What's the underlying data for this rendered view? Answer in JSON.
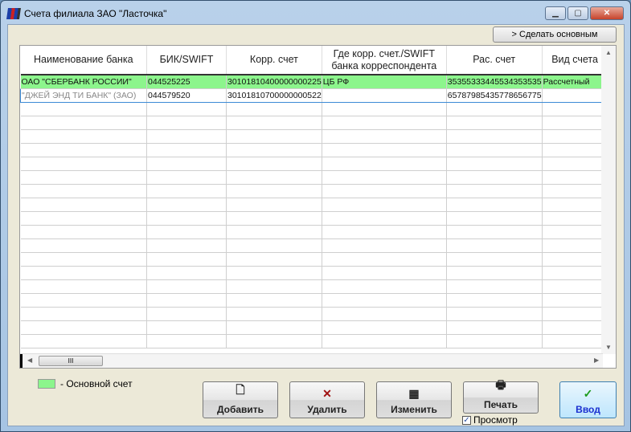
{
  "window": {
    "title": "Счета филиала ЗАО \"Ласточка\""
  },
  "toolbar": {
    "make_main_label": "> Сделать основным"
  },
  "table": {
    "columns": [
      "Наименование банка",
      "БИК/SWIFT",
      "Корр. счет",
      "Где корр. счет./SWIFT банка корреспондента",
      "Рас. счет",
      "Вид счета"
    ],
    "rows": [
      {
        "cells": [
          "ОАО \"СБЕРБАНК РОССИИ\"",
          "044525225",
          "30101810400000000225",
          "ЦБ РФ",
          "35355333445534353535",
          "Рассчетный"
        ],
        "main": true
      },
      {
        "cells": [
          "\"ДЖЕЙ ЭНД ТИ БАНК\" (ЗАО)",
          "044579520",
          "30101810700000000522",
          "",
          "65787985435778656775",
          ""
        ],
        "main": false
      }
    ]
  },
  "legend": {
    "label": "- Основной счет",
    "color": "#8cf58c"
  },
  "buttons": {
    "add": "Добавить",
    "delete": "Удалить",
    "edit": "Изменить",
    "print": "Печать",
    "enter": "Ввод"
  },
  "preview": {
    "label": "Просмотр",
    "checked": true
  }
}
